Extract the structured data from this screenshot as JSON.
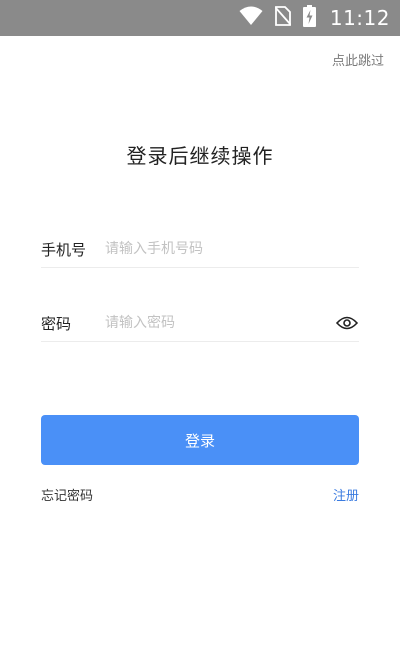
{
  "status_bar": {
    "time": "11:12",
    "icons": [
      "wifi-icon",
      "no-sim-icon",
      "battery-charging-icon"
    ],
    "background": "#8a8a8a"
  },
  "skip_label": "点此跳过",
  "title": "登录后继续操作",
  "phone_field": {
    "label": "手机号",
    "placeholder": "请输入手机号码",
    "value": ""
  },
  "password_field": {
    "label": "密码",
    "placeholder": "请输入密码",
    "value": "",
    "visibility_icon": "eye-icon"
  },
  "login_button": {
    "label": "登录",
    "color": "#4a90f7"
  },
  "forgot_password_label": "忘记密码",
  "register_label": "注册",
  "link_color": "#3a7be0"
}
